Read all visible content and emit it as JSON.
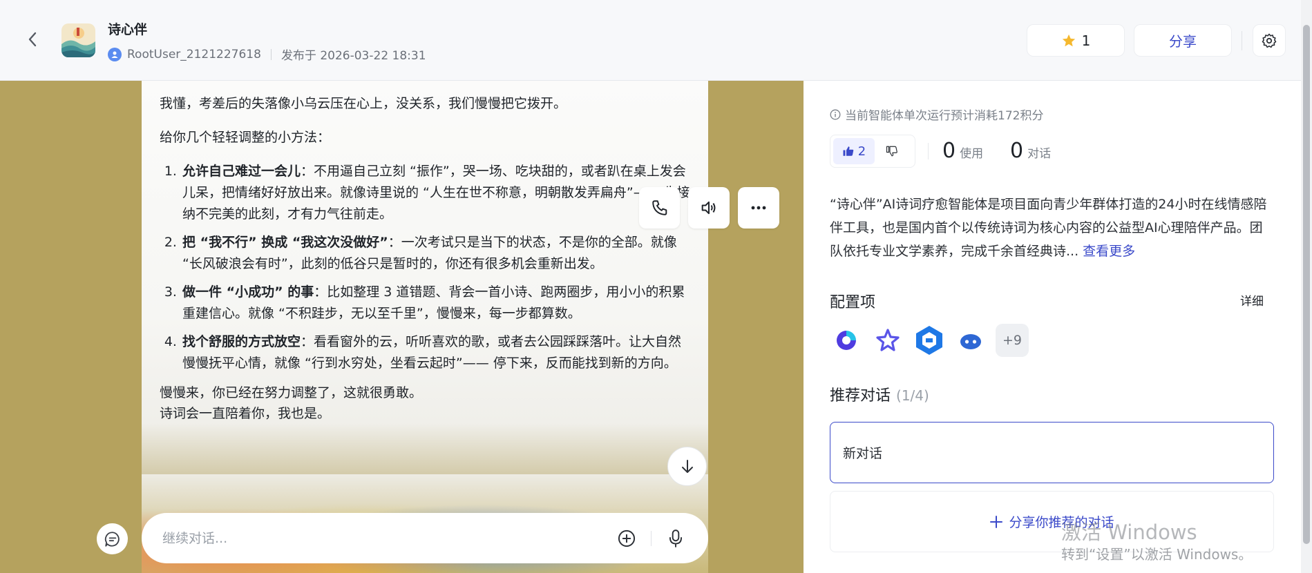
{
  "header": {
    "title": "诗心伴",
    "username": "RootUser_2121227618",
    "published": "发布于 2026-03-22 18:31",
    "star_count": "1",
    "share_label": "分享"
  },
  "chat": {
    "intro": "我懂，考差后的失落像小乌云压在心上，没关系，我们慢慢把它拨开。",
    "lead": "给你几个轻轻调整的小方法：",
    "tips": [
      {
        "title": "允许自己难过一会儿",
        "body": "：不用逼自己立刻 “振作”，哭一场、吃块甜的，或者趴在桌上发会儿呆，把情绪好好放出来。就像诗里说的 “人生在世不称意，明朝散发弄扁舟”—— 先接纳不完美的此刻，才有力气往前走。"
      },
      {
        "title": "把 “我不行” 换成 “我这次没做好”",
        "body": "：一次考试只是当下的状态，不是你的全部。就像 “长风破浪会有时”，此刻的低谷只是暂时的，你还有很多机会重新出发。"
      },
      {
        "title": "做一件 “小成功” 的事",
        "body": "：比如整理 3 道错题、背会一首小诗、跑两圈步，用小小的积累重建信心。就像 “不积跬步，无以至千里”，慢慢来，每一步都算数。"
      },
      {
        "title": "找个舒服的方式放空",
        "body": "：看看窗外的云，听听喜欢的歌，或者去公园踩踩落叶。让大自然慢慢抚平心情，就像 “行到水穷处，坐看云起时”—— 停下来，反而能找到新的方向。"
      }
    ],
    "closing_1": "慢慢来，你已经在努力调整了，这就很勇敢。",
    "closing_2": "诗词会一直陪着你，我也是。",
    "input_placeholder": "继续对话..."
  },
  "panel": {
    "cost_note": "当前智能体单次运行预计消耗172积分",
    "likes": "2",
    "uses_num": "0",
    "uses_label": "使用",
    "convs_num": "0",
    "convs_label": "对话",
    "description": "“诗心伴”AI诗词疗愈智能体是项目面向青少年群体打造的24小时在线情感陪伴工具，也是国内首个以传统诗词为核心内容的公益型AI心理陪伴产品。团队依托专业文学素养，完成千余首经典诗...",
    "see_more": "查看更多",
    "config_title": "配置项",
    "detail_label": "详细",
    "plugins_more": "+9",
    "rec_title": "推荐对话",
    "rec_count": "(1/4)",
    "rec_item": "新对话",
    "share_rec_label": "分享你推荐的对话"
  },
  "watermark": {
    "line1": "激活 Windows",
    "line2": "转到“设置”以激活 Windows。"
  },
  "colors": {
    "accent": "#3a49c9",
    "chat_bg": "#b5a25e",
    "star": "#f5b82e"
  }
}
